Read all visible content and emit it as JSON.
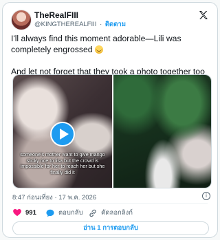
{
  "header": {
    "display_name": "TheRealFIII",
    "handle": "@KINGTHEREALFIII",
    "separator": "·",
    "follow_label": "ติดตาม"
  },
  "tweet": {
    "text_line1": "I'll always find this moment adorable—Lili was completely engrossed",
    "text_line2": "And let not forget that they took a photo together too"
  },
  "media": {
    "caption": "someone's mother want to give mango sticky rice to lisa but the crowd is impossible for her to reach her but she finally did it"
  },
  "meta": {
    "time": "8:47 ก่อนเที่ยง",
    "separator": "·",
    "date": "17 พ.ค. 2026"
  },
  "actions": {
    "likes_count": "991",
    "reply_label": "ตอบกลับ",
    "copy_link_label": "คัดลอกลิงก์"
  },
  "replies_button_label": "อ่าน 1 การตอบกลับ",
  "colors": {
    "accent": "#1d9bf0",
    "like_red": "#f91880",
    "text_primary": "#0f1419",
    "text_secondary": "#536471"
  },
  "icons": [
    "x-logo-icon",
    "play-icon",
    "info-icon",
    "heart-icon",
    "reply-icon",
    "link-icon"
  ]
}
